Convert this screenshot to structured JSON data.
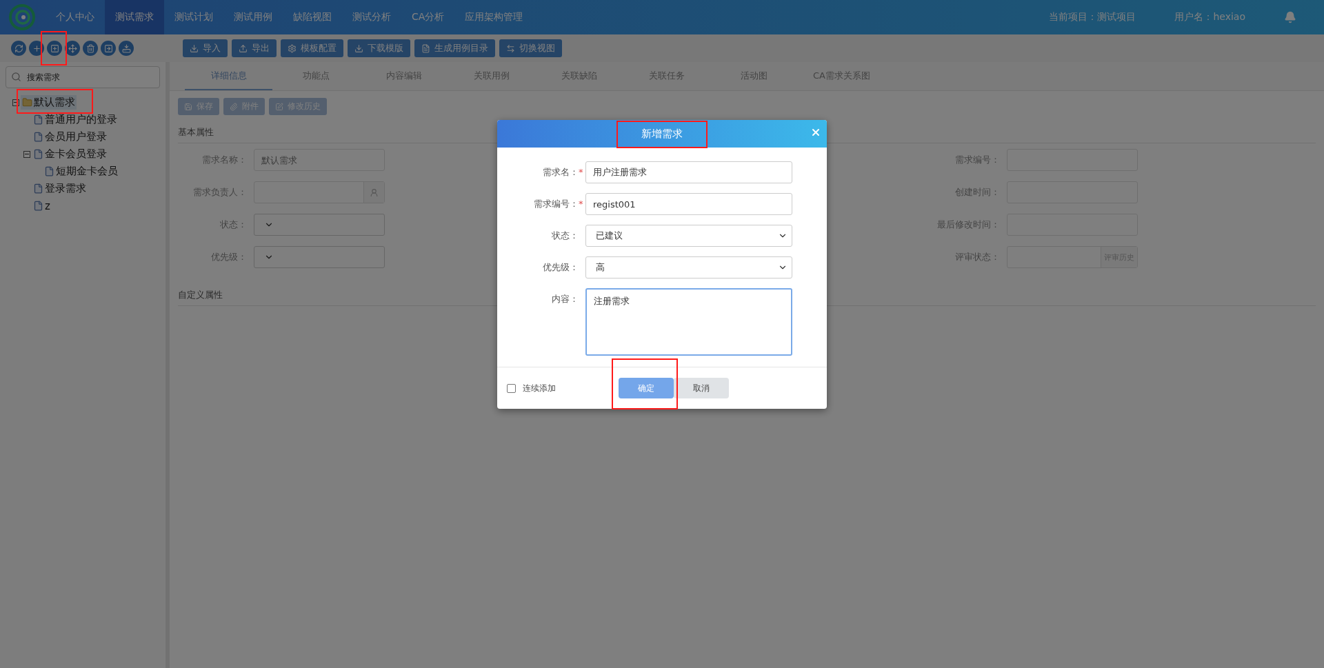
{
  "header": {
    "nav": [
      {
        "label": "个人中心",
        "selected": false
      },
      {
        "label": "测试需求",
        "selected": true
      },
      {
        "label": "测试计划",
        "selected": false
      },
      {
        "label": "测试用例",
        "selected": false
      },
      {
        "label": "缺陷视图",
        "selected": false
      },
      {
        "label": "测试分析",
        "selected": false
      },
      {
        "label": "CA分析",
        "selected": false
      },
      {
        "label": "应用架构管理",
        "selected": false
      }
    ],
    "project": "当前项目：测试项目",
    "user": "用户名：hexiao"
  },
  "tree_toolbar": [
    {
      "kind": "refresh",
      "highlighted": false
    },
    {
      "kind": "add",
      "highlighted": false
    },
    {
      "kind": "add_child",
      "highlighted": true
    },
    {
      "kind": "move",
      "highlighted": false
    },
    {
      "kind": "delete",
      "highlighted": false
    },
    {
      "kind": "export",
      "highlighted": false
    },
    {
      "kind": "import",
      "highlighted": false
    }
  ],
  "actions": [
    {
      "kind": "import",
      "label": "导入"
    },
    {
      "kind": "export",
      "label": "导出"
    },
    {
      "kind": "settings",
      "label": "模板配置"
    },
    {
      "kind": "download",
      "label": "下载模版"
    },
    {
      "kind": "document",
      "label": "生成用例目录"
    },
    {
      "kind": "switch",
      "label": "切换视图"
    }
  ],
  "search": {
    "placeholder": "搜索需求"
  },
  "tree": [
    {
      "label": "默认需求",
      "kind": "folder",
      "selected": true,
      "highlighted": true,
      "expanded": true,
      "children": [
        {
          "label": "普通用户的登录",
          "kind": "file",
          "selected": false,
          "highlighted": false
        },
        {
          "label": "会员用户登录",
          "kind": "file",
          "selected": false,
          "highlighted": false
        },
        {
          "label": "金卡会员登录",
          "kind": "file",
          "selected": false,
          "highlighted": false,
          "expanded": true,
          "children": [
            {
              "label": "短期金卡会员",
              "kind": "file",
              "selected": false,
              "highlighted": false
            }
          ]
        },
        {
          "label": "登录需求",
          "kind": "file",
          "selected": false,
          "highlighted": false
        },
        {
          "label": "z",
          "kind": "file",
          "selected": false,
          "highlighted": false
        }
      ]
    }
  ],
  "tabs": [
    {
      "label": "详细信息",
      "selected": true
    },
    {
      "label": "功能点",
      "selected": false
    },
    {
      "label": "内容编辑",
      "selected": false
    },
    {
      "label": "关联用例",
      "selected": false
    },
    {
      "label": "关联缺陷",
      "selected": false
    },
    {
      "label": "关联任务",
      "selected": false
    },
    {
      "label": "活动图",
      "selected": false
    },
    {
      "label": "CA需求关系图",
      "selected": false
    }
  ],
  "detail_buttons": [
    {
      "kind": "save",
      "label": "保存"
    },
    {
      "kind": "attach",
      "label": "附件"
    },
    {
      "kind": "history",
      "label": "修改历史"
    }
  ],
  "basic_section": "基本属性",
  "fields_left": [
    {
      "label": "需求名称：",
      "kind": "text",
      "placeholder": "默认需求"
    },
    {
      "label": "需求负责人：",
      "kind": "picker"
    },
    {
      "label": "状态：",
      "kind": "select"
    },
    {
      "label": "优先级：",
      "kind": "select"
    }
  ],
  "fields_right": [
    {
      "label": "需求编号：",
      "kind": "text"
    },
    {
      "label": "创建时间：",
      "kind": "text"
    },
    {
      "label": "最后修改时间：",
      "kind": "text"
    },
    {
      "label": "评审状态：",
      "kind": "history",
      "button": "评审历史"
    }
  ],
  "custom_section": "自定义属性",
  "dialog": {
    "title": "新增需求",
    "title_highlighted": true,
    "fields": [
      {
        "label": "需求名：",
        "mark": "*",
        "kind": "text",
        "value": "用户注册需求"
      },
      {
        "label": "需求编号：",
        "mark": "*",
        "kind": "text",
        "value": "regist001"
      },
      {
        "label": "状态：",
        "kind": "select",
        "value": "已建议"
      },
      {
        "label": "优先级：",
        "kind": "select",
        "value": "高"
      },
      {
        "label": "内容：",
        "kind": "textarea",
        "value": "注册需求"
      }
    ],
    "continuous": {
      "label": "连续添加",
      "checked": false
    },
    "buttons": [
      {
        "kind": "primary",
        "label": "确定",
        "highlighted": true
      },
      {
        "kind": "secondary",
        "label": "取消",
        "highlighted": false
      }
    ]
  }
}
